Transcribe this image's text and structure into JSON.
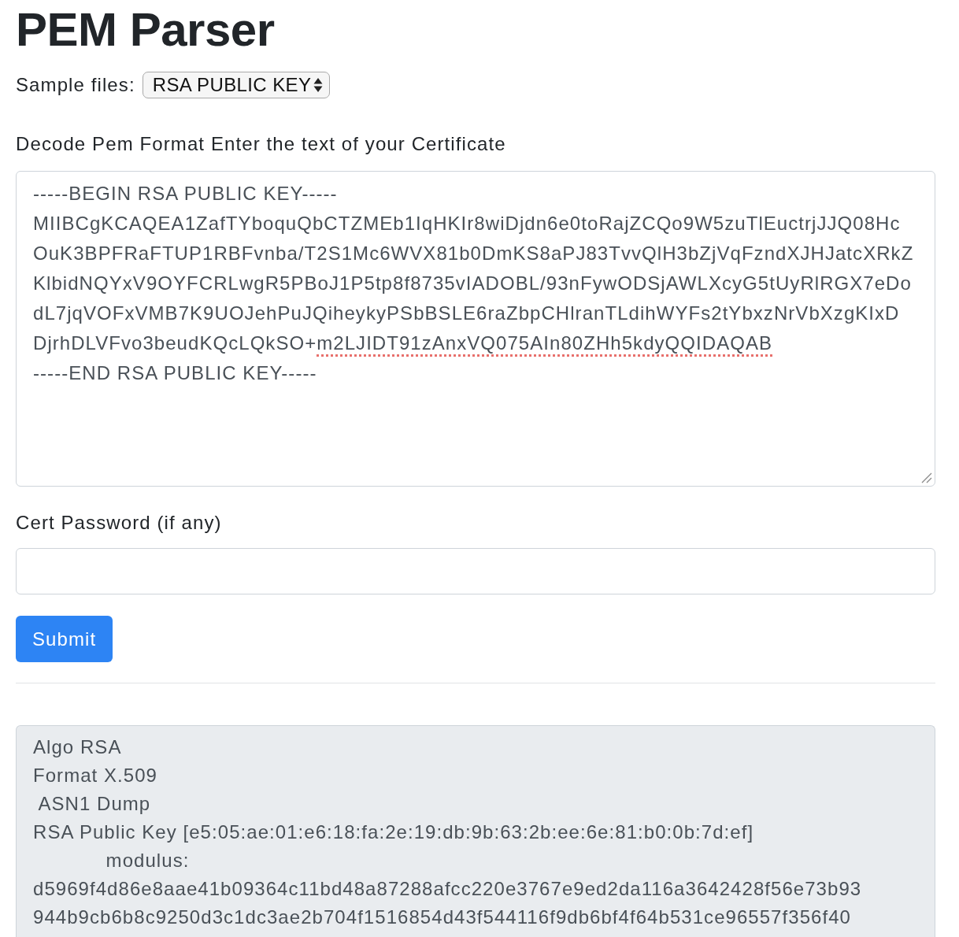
{
  "title": "PEM Parser",
  "sample_files": {
    "label": "Sample files:",
    "value": "RSA PUBLIC KEY"
  },
  "pem_input": {
    "label": "Decode Pem Format Enter the text of your Certificate",
    "lines": [
      [
        {
          "text": "-----BEGIN RSA PUBLIC KEY-----",
          "misspelled": false
        }
      ],
      [
        {
          "text": "MIIBCgKCAQEA1ZafTYboquQbCTZMEb1IqHKIr8wiDjdn6e0toRajZCQo9W5zuTlEuctrjJJQ08Hc",
          "misspelled": false
        }
      ],
      [
        {
          "text": "OuK3BPFRaFTUP1RBFvnba/T2S1Mc6WVX81b0DmKS8aPJ83TvvQlH3bZjVqFzndXJHJatcXRkZ",
          "misspelled": false
        }
      ],
      [
        {
          "text": "KlbidNQYxV9OYFCRLwgR5PBoJ1P5tp8f8735vIADOBL/93nFywODSjAWLXcyG5tUyRlRGX7eDo",
          "misspelled": false
        }
      ],
      [
        {
          "text": "dL7jqVOFxVMB7K9UOJehPuJQiheykyPSbBSLE6raZbpCHlranTLdihWYFs2tYbxzNrVbXzgKIxD",
          "misspelled": false
        }
      ],
      [
        {
          "text": "DjrhDLVFvo3beudKQcLQkSO+",
          "misspelled": false
        },
        {
          "text": "m2LJIDT91zAnxVQ075AIn80ZHh5kdyQQIDAQAB",
          "misspelled": true
        }
      ],
      [
        {
          "text": "-----END RSA PUBLIC KEY-----",
          "misspelled": false
        }
      ]
    ]
  },
  "password": {
    "label": "Cert Password (if any)"
  },
  "submit_button": "Submit",
  "output": {
    "readonly": true,
    "lines": [
      "Algo RSA",
      "Format X.509",
      " ASN1 Dump",
      "RSA Public Key [e5:05:ae:01:e6:18:fa:2e:19:db:9b:63:2b:ee:6e:81:b0:0b:7d:ef]",
      "            modulus:",
      "d5969f4d86e8aae41b09364c11bd48a87288afcc220e3767e9ed2da116a3642428f56e73b93",
      "944b9cb6b8c9250d3c1dc3ae2b704f1516854d43f544116f9db6bf4f64b531ce96557f356f40"
    ]
  }
}
